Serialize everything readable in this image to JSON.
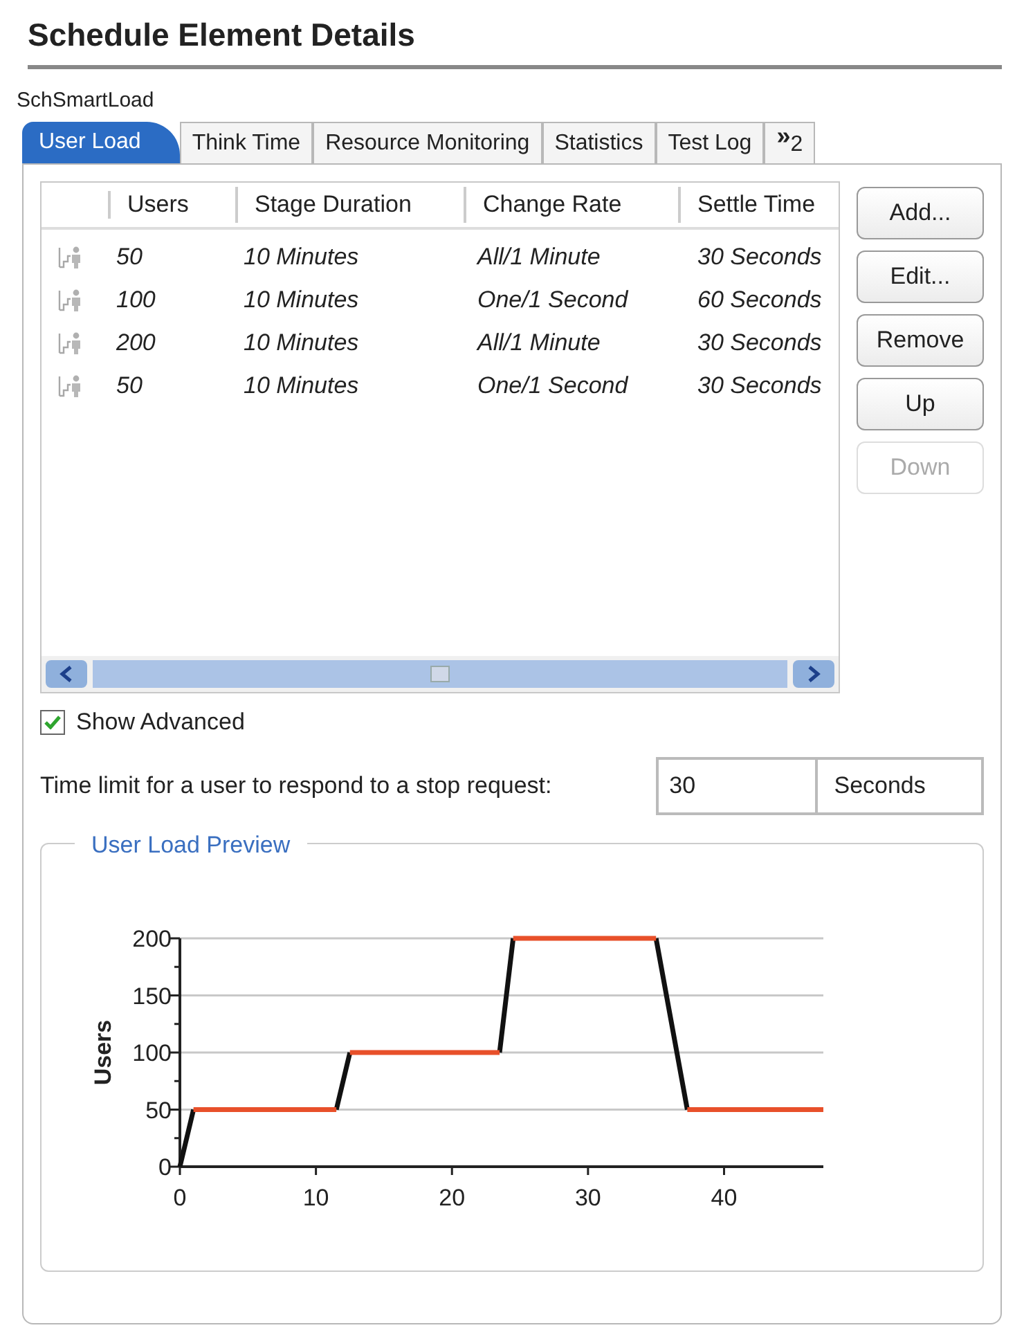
{
  "title": "Schedule Element Details",
  "element_name": "SchSmartLoad",
  "tabs": [
    {
      "label": "User Load",
      "selected": true
    },
    {
      "label": "Think Time",
      "selected": false
    },
    {
      "label": "Resource Monitoring",
      "selected": false
    },
    {
      "label": "Statistics",
      "selected": false
    },
    {
      "label": "Test Log",
      "selected": false
    }
  ],
  "tab_overflow": {
    "glyph": "»",
    "count": "2"
  },
  "table": {
    "columns": [
      "Users",
      "Stage Duration",
      "Change Rate",
      "Settle Time"
    ],
    "rows": [
      [
        "50",
        "10 Minutes",
        "All/1 Minute",
        "30 Seconds"
      ],
      [
        "100",
        "10 Minutes",
        "One/1 Second",
        "60 Seconds"
      ],
      [
        "200",
        "10 Minutes",
        "All/1 Minute",
        "30 Seconds"
      ],
      [
        "50",
        "10 Minutes",
        "One/1 Second",
        "30 Seconds"
      ]
    ]
  },
  "buttons": [
    {
      "label": "Add...",
      "disabled": false
    },
    {
      "label": "Edit...",
      "disabled": false
    },
    {
      "label": "Remove",
      "disabled": false
    },
    {
      "label": "Up",
      "disabled": false
    },
    {
      "label": "Down",
      "disabled": true
    }
  ],
  "show_advanced": {
    "label": "Show Advanced",
    "checked": true
  },
  "time_limit": {
    "label": "Time limit for a user to respond to a stop request:",
    "value": "30",
    "unit": "Seconds"
  },
  "preview": {
    "title": "User Load Preview",
    "chart_data": {
      "type": "line",
      "ylabel": "Users",
      "x": [
        0,
        1,
        1,
        11.5,
        11.5,
        12.5,
        12.5,
        23.5,
        23.5,
        24.5,
        24.5,
        35,
        35,
        37.3,
        37.3,
        47.3
      ],
      "grid": true,
      "series": [
        {
          "color": "#111111",
          "values": [
            0,
            50,
            null,
            null,
            50,
            100,
            null,
            null,
            100,
            200,
            null,
            null,
            200,
            50,
            null,
            null
          ]
        },
        {
          "color": "#e8502a",
          "values": [
            null,
            null,
            50,
            50,
            null,
            null,
            100,
            100,
            null,
            null,
            200,
            200,
            null,
            null,
            50,
            50
          ]
        }
      ],
      "xlim": [
        0,
        47.3
      ],
      "ylim": [
        0,
        200
      ],
      "xticks": [
        0,
        10,
        20,
        30,
        40
      ],
      "yticks": [
        0,
        50,
        100,
        150,
        200
      ]
    }
  }
}
